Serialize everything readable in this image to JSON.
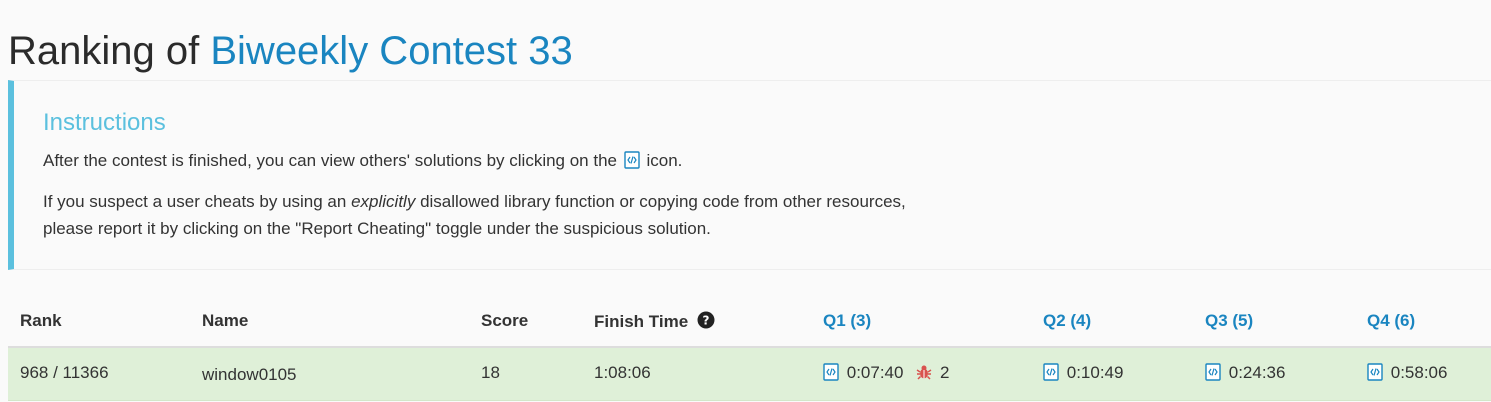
{
  "header": {
    "title_prefix": "Ranking of",
    "contest_name": "Biweekly Contest 33"
  },
  "instructions": {
    "title": "Instructions",
    "line1_before": "After the contest is finished, you can view others' solutions by clicking on the",
    "line1_after": "icon.",
    "line2_before": "If you suspect a user cheats by using an",
    "line2_emphasis": "explicitly",
    "line2_after": "disallowed library function or copying code from other resources,",
    "line3": "please report it by clicking on the \"Report Cheating\" toggle under the suspicious solution."
  },
  "table": {
    "headers": {
      "rank": "Rank",
      "name": "Name",
      "score": "Score",
      "finish_time": "Finish Time",
      "q1": "Q1 (3)",
      "q2": "Q2 (4)",
      "q3": "Q3 (5)",
      "q4": "Q4 (6)"
    },
    "rows": [
      {
        "rank": "968 / 11366",
        "name": "window0105",
        "score": "18",
        "finish_time": "1:08:06",
        "q1_time": "0:07:40",
        "q1_wrong_count": "2",
        "q2_time": "0:10:49",
        "q3_time": "0:24:36",
        "q4_time": "0:58:06"
      }
    ]
  },
  "colors": {
    "accent": "#1a85c0",
    "instructions_accent": "#5bc0de",
    "row_success": "#dff0d8",
    "bug": "#d9534f"
  },
  "icons": {
    "solution": "code-file-icon",
    "help": "question-circle-icon",
    "wrong": "bug-icon"
  }
}
